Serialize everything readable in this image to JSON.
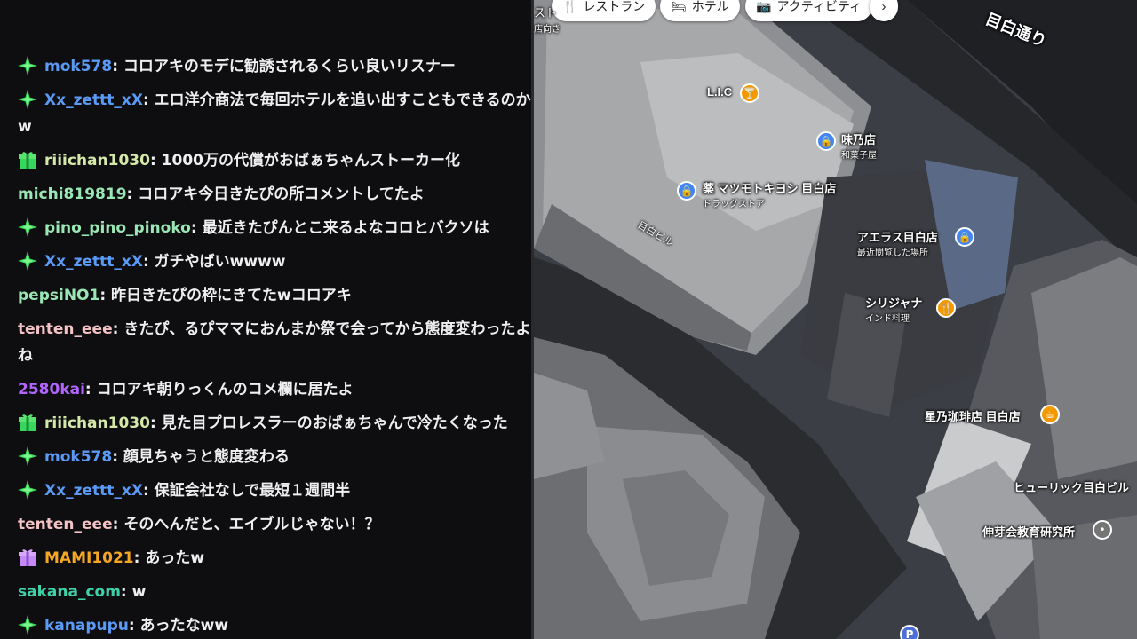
{
  "chat": {
    "messages": [
      {
        "badge": "star",
        "user": "mok578",
        "color": "#5b9bf8",
        "text": "コロアキのモデに勧誘されるくらい良いリスナー"
      },
      {
        "badge": "star",
        "user": "Xx_zettt_xX",
        "color": "#5b9bf8",
        "text": "エロ洋介商法で毎回ホテルを追い出すこともできるのかw"
      },
      {
        "badge": "gift",
        "user": "riiichan1030",
        "color": "#d4e8a8",
        "text": "1000万の代償がおばぁちゃんストーカー化"
      },
      {
        "badge": "",
        "user": "michi819819",
        "color": "#9ae6b4",
        "text": "コロアキ今日きたぴの所コメントしてたよ"
      },
      {
        "badge": "star",
        "user": "pino_pino_pinoko",
        "color": "#9ae6b4",
        "text": "最近きたぴんとこ来るよなコロとバクソは"
      },
      {
        "badge": "star",
        "user": "Xx_zettt_xX",
        "color": "#5b9bf8",
        "text": "ガチやばいwwww"
      },
      {
        "badge": "",
        "user": "pepsiNO1",
        "color": "#9ae6b4",
        "text": "昨日きたぴの枠にきてたwコロアキ"
      },
      {
        "badge": "",
        "user": "tenten_eee",
        "color": "#f4c3c6",
        "text": "きたぴ、るぴママにおんまか祭で会ってから態度変わったよね"
      },
      {
        "badge": "",
        "user": "2580kai",
        "color": "#b266ff",
        "text": "コロアキ朝りっくんのコメ欄に居たよ"
      },
      {
        "badge": "gift",
        "user": "riiichan1030",
        "color": "#d4e8a8",
        "text": "見た目プロレスラーのおばぁちゃんで冷たくなった"
      },
      {
        "badge": "star",
        "user": "mok578",
        "color": "#5b9bf8",
        "text": "顔見ちゃうと態度変わる"
      },
      {
        "badge": "star",
        "user": "Xx_zettt_xX",
        "color": "#5b9bf8",
        "text": "保証会社なしで最短１週間半"
      },
      {
        "badge": "",
        "user": "tenten_eee",
        "color": "#f4c3c6",
        "text": "そのへんだと、エイブルじゃない！？"
      },
      {
        "badge": "giftp",
        "user": "MAMI1021",
        "color": "#f5a623",
        "text": "あったw"
      },
      {
        "badge": "",
        "user": "sakana_com",
        "color": "#3fd1a8",
        "text": "w"
      },
      {
        "badge": "star",
        "user": "kanapupu",
        "color": "#5b9bf8",
        "text": "あったなww"
      }
    ]
  },
  "map": {
    "chips": [
      {
        "icon": "🍴",
        "label": "レストラン"
      },
      {
        "icon": "🛏",
        "label": "ホテル"
      },
      {
        "icon": "📷",
        "label": "アクティビティ"
      }
    ],
    "more_icon": "chevron-right-icon",
    "road_label": "目白通り",
    "corner_text": [
      "スト",
      "店向き"
    ],
    "building_label": "目白ビル",
    "places": [
      {
        "name": "L.I.C",
        "sub": "",
        "color": "#f29900",
        "icon": "cocktail"
      },
      {
        "name": "味乃店",
        "sub": "和菓子屋",
        "color": "#4285f4",
        "icon": "bag"
      },
      {
        "name": "薬 マツモトキヨシ 目白店",
        "sub": "ドラッグストア",
        "color": "#4285f4",
        "icon": "bag"
      },
      {
        "name": "アエラス目白店",
        "sub": "最近閲覧した場所",
        "color": "#4285f4",
        "icon": "bag"
      },
      {
        "name": "シリジャナ",
        "sub": "インド料理",
        "color": "#f29900",
        "icon": "fork"
      },
      {
        "name": "星乃珈琲店 目白店",
        "sub": "",
        "color": "#f29900",
        "icon": "cup"
      },
      {
        "name": "ヒューリック目白ビル",
        "sub": "",
        "color": "",
        "icon": ""
      },
      {
        "name": "伸芽会教育研究所",
        "sub": "",
        "color": "#757575",
        "icon": "dot"
      },
      {
        "name": "P",
        "sub": "",
        "color": "#4e6fd8",
        "icon": "parking"
      }
    ]
  }
}
